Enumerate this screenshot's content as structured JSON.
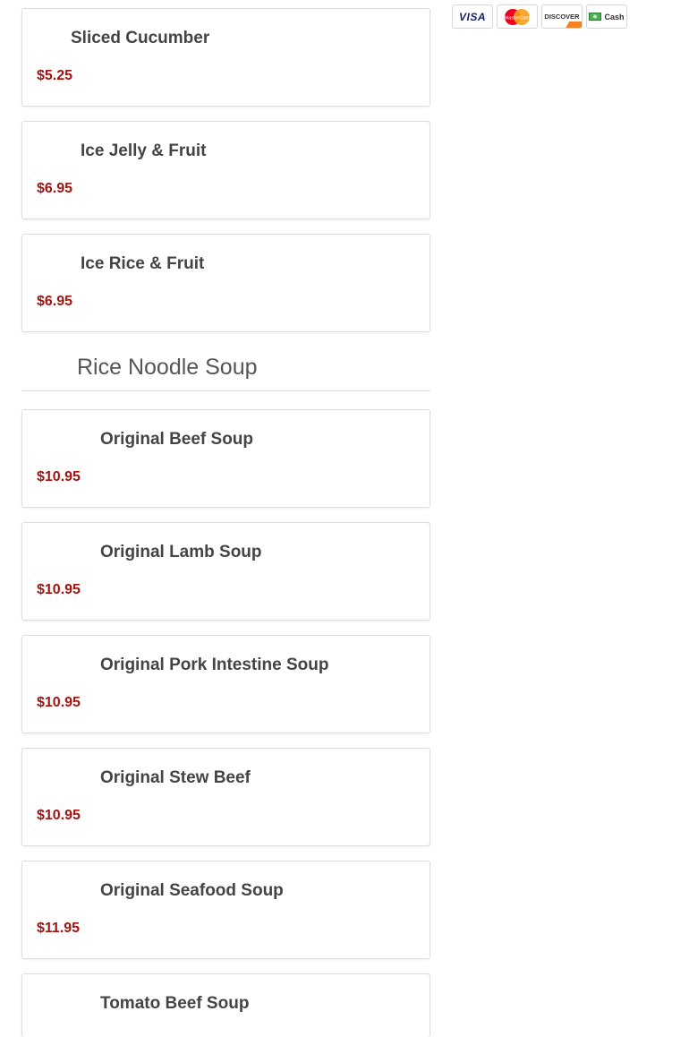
{
  "menu": {
    "group1": [
      {
        "name": "Sliced Cucumber",
        "price": "$5.25"
      },
      {
        "name": "Ice Jelly & Fruit",
        "price": "$6.95"
      },
      {
        "name": "Ice Rice & Fruit",
        "price": "$6.95"
      }
    ],
    "section_title": "Rice Noodle Soup",
    "group2": [
      {
        "name": "Original Beef Soup",
        "price": "$10.95"
      },
      {
        "name": "Original Lamb Soup",
        "price": "$10.95"
      },
      {
        "name": "Original Pork Intestine Soup",
        "price": "$10.95"
      },
      {
        "name": "Original Stew Beef",
        "price": "$10.95"
      },
      {
        "name": "Original Seafood Soup",
        "price": "$11.95"
      },
      {
        "name": "Tomato Beef Soup",
        "price": ""
      }
    ]
  },
  "payments": {
    "visa": "VISA",
    "mastercard": "MasterCard",
    "discover": "DISCOVER",
    "cash": "Cash"
  },
  "colors": {
    "price": "#a5130f",
    "border": "#dddddd",
    "mastercard_red": "#eb001b",
    "mastercard_orange": "#f79e1b",
    "discover_orange": "#f58220",
    "cash_green": "#4caf50"
  }
}
